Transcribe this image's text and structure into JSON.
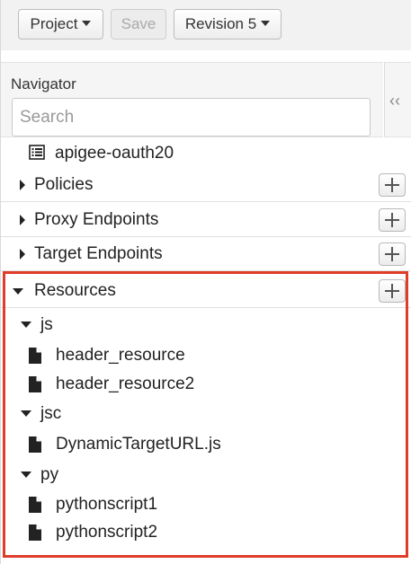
{
  "toolbar": {
    "project_label": "Project",
    "save_label": "Save",
    "revision_label": "Revision 5"
  },
  "navigator": {
    "title": "Navigator",
    "search_placeholder": "Search",
    "collapse_glyph": "‹‹",
    "proxy_name": "apigee-oauth20",
    "sections": {
      "policies": "Policies",
      "proxy_endpoints": "Proxy Endpoints",
      "target_endpoints": "Target Endpoints",
      "resources": "Resources"
    },
    "resources": {
      "js": {
        "label": "js",
        "files": [
          "header_resource",
          "header_resource2"
        ]
      },
      "jsc": {
        "label": "jsc",
        "files": [
          "DynamicTargetURL.js"
        ]
      },
      "py": {
        "label": "py",
        "files": [
          "pythonscript1",
          "pythonscript2"
        ]
      }
    }
  },
  "colors": {
    "highlight": "#e03c2a",
    "toolbar_bg": "#f2f2f2"
  }
}
